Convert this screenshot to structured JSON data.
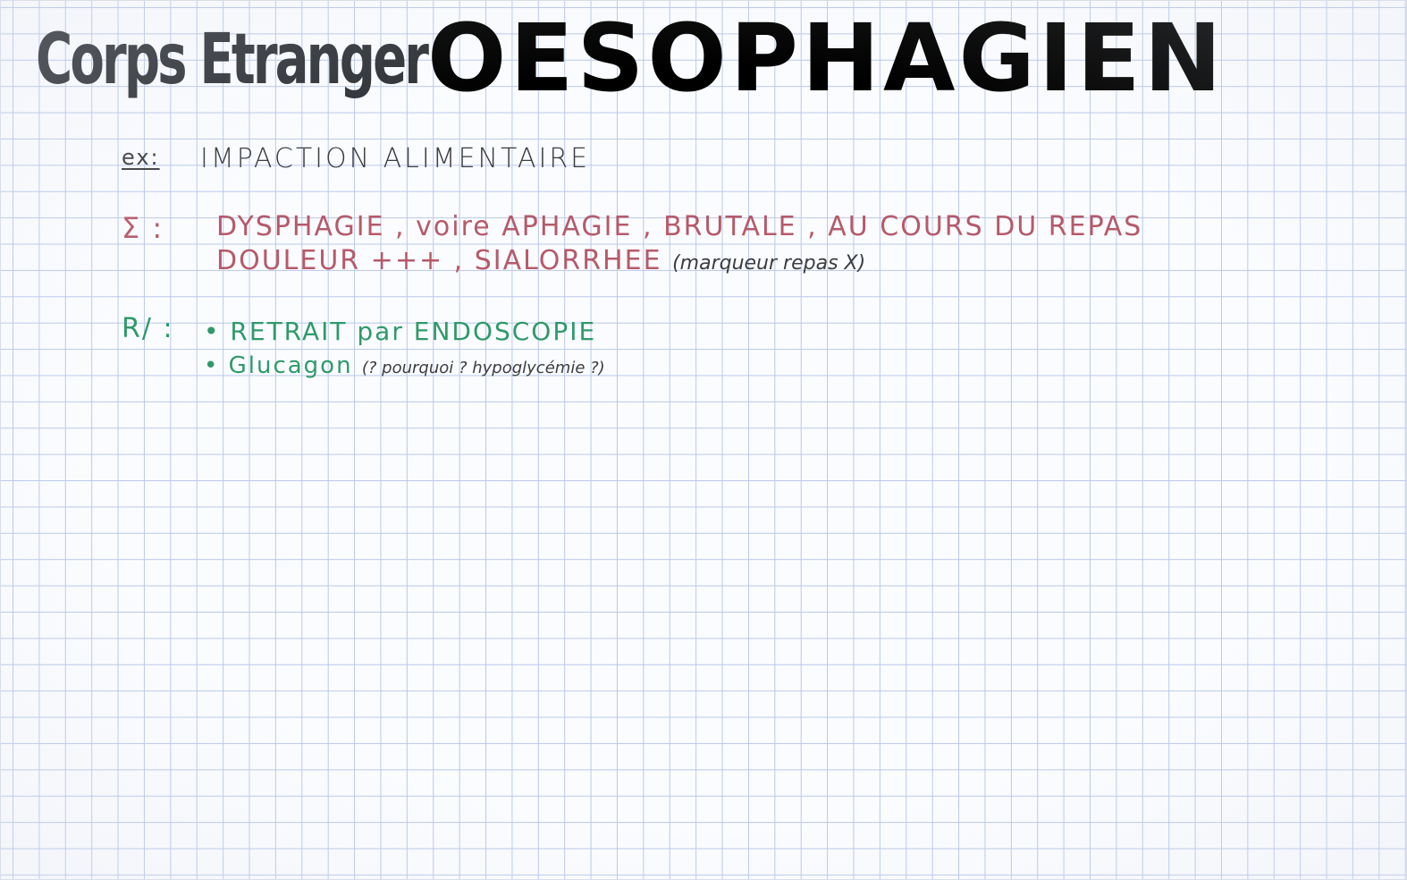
{
  "title": {
    "part1": "Corps Etranger",
    "part2": "OESOPHAGIEN"
  },
  "example": {
    "label": "ex:",
    "text": "IMPACTION ALIMENTAIRE"
  },
  "symptoms": {
    "label": "Σ :",
    "line1": "DYSPHAGIE , voire APHAGIE , BRUTALE , AU COURS DU REPAS",
    "line2": "DOULEUR +++ , SIALORRHEE",
    "line2_note": "(marqueur repas X)"
  },
  "treatment": {
    "label": "R/ :",
    "item1": "• RETRAIT par ENDOSCOPIE",
    "item2": "• Glucagon",
    "item2_note": "(? pourquoi ? hypoglycémie ?)"
  }
}
